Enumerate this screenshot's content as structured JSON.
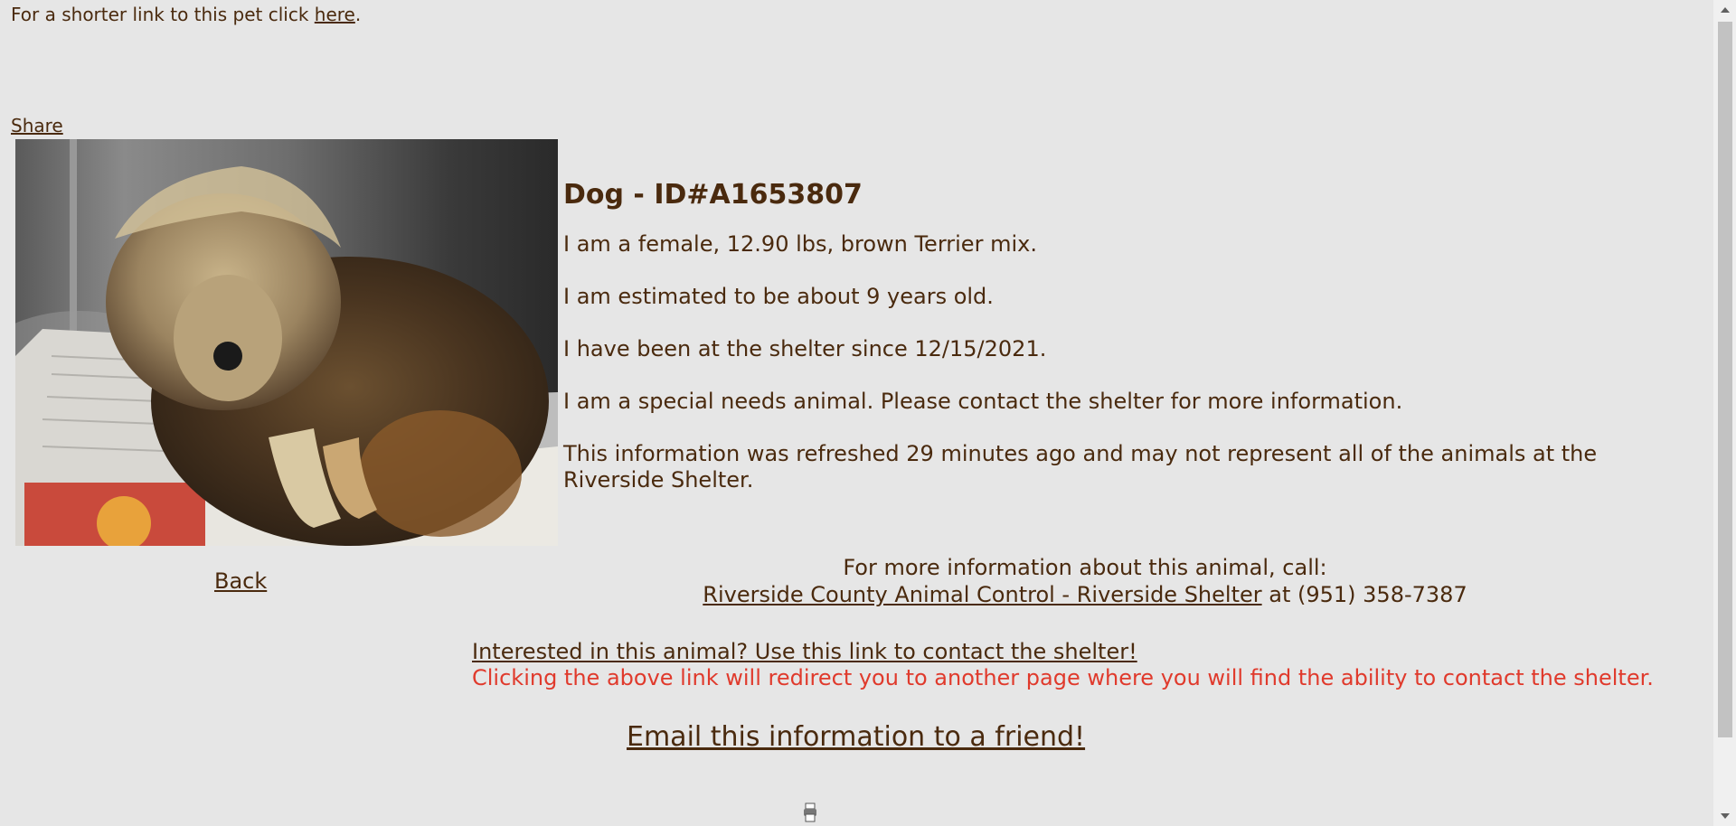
{
  "top": {
    "short_link_prefix": "For a shorter link to this pet click ",
    "short_link_label": "here",
    "short_link_suffix": ".",
    "share_label": "Share"
  },
  "animal": {
    "title": "Dog - ID#A1653807",
    "description": "I am a female, 12.90 lbs, brown Terrier mix.",
    "age": "I am estimated to be about 9 years old.",
    "since": "I have been at the shelter since 12/15/2021.",
    "special": "I am a special needs animal. Please contact the shelter for more information.",
    "refresh": "This information was refreshed 29 minutes ago and may not represent all of the animals at the Riverside Shelter."
  },
  "nav": {
    "back_label": "Back"
  },
  "contact": {
    "call_prefix": "For more information about this animal, call:",
    "shelter_name": "Riverside County Animal Control - Riverside Shelter",
    "phone_text": " at (951) 358-7387",
    "interest_link": "Interested in this animal? Use this link to contact the shelter!",
    "redirect_note": "Clicking the above link will redirect you to another page where you will find the ability to contact the shelter.",
    "email_link": "Email this information to a friend!"
  },
  "colors": {
    "background": "#e6e6e6",
    "text": "#4a2a0e",
    "warning": "#e03a2c"
  },
  "icons": {
    "scroll_up": "triangle-up",
    "scroll_down": "triangle-down"
  }
}
